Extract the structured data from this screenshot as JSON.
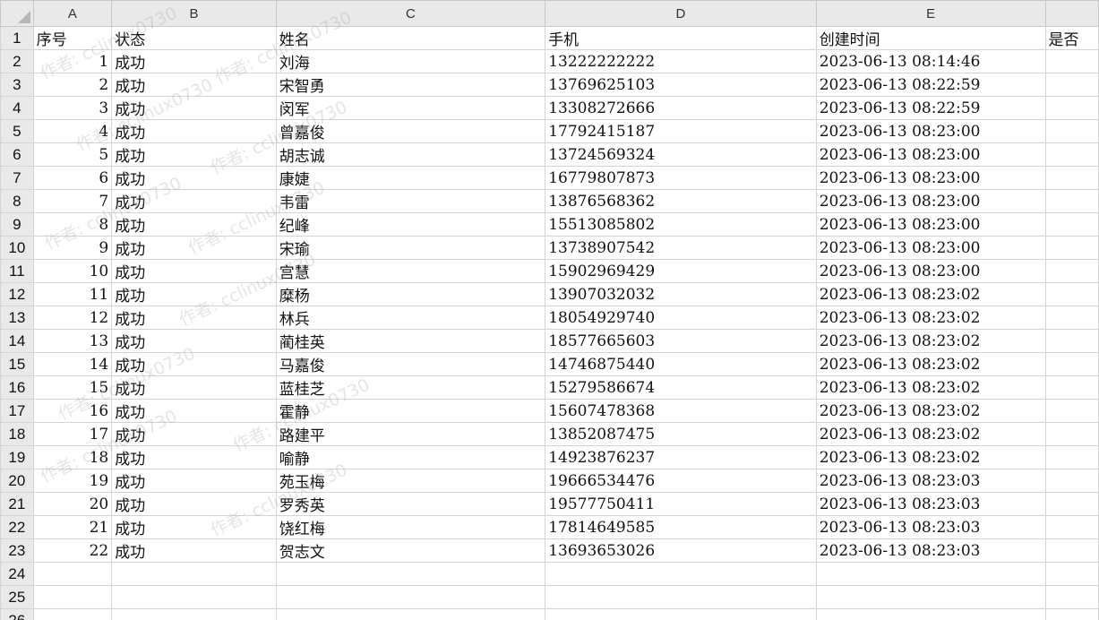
{
  "columns": {
    "A": "A",
    "B": "B",
    "C": "C",
    "D": "D",
    "E": "E"
  },
  "headers": {
    "seq": "序号",
    "status": "状态",
    "name": "姓名",
    "phone": "手机",
    "created": "创建时间",
    "extra": "是否"
  },
  "rows": [
    {
      "seq": "1",
      "status": "成功",
      "name": "刘海",
      "phone": "13222222222",
      "created": "2023-06-13 08:14:46"
    },
    {
      "seq": "2",
      "status": "成功",
      "name": "宋智勇",
      "phone": "13769625103",
      "created": "2023-06-13 08:22:59"
    },
    {
      "seq": "3",
      "status": "成功",
      "name": "闵军",
      "phone": "13308272666",
      "created": "2023-06-13 08:22:59"
    },
    {
      "seq": "4",
      "status": "成功",
      "name": "曾嘉俊",
      "phone": "17792415187",
      "created": "2023-06-13 08:23:00"
    },
    {
      "seq": "5",
      "status": "成功",
      "name": "胡志诚",
      "phone": "13724569324",
      "created": "2023-06-13 08:23:00"
    },
    {
      "seq": "6",
      "status": "成功",
      "name": "康婕",
      "phone": "16779807873",
      "created": "2023-06-13 08:23:00"
    },
    {
      "seq": "7",
      "status": "成功",
      "name": "韦雷",
      "phone": "13876568362",
      "created": "2023-06-13 08:23:00"
    },
    {
      "seq": "8",
      "status": "成功",
      "name": "纪峰",
      "phone": "15513085802",
      "created": "2023-06-13 08:23:00"
    },
    {
      "seq": "9",
      "status": "成功",
      "name": "宋瑜",
      "phone": "13738907542",
      "created": "2023-06-13 08:23:00"
    },
    {
      "seq": "10",
      "status": "成功",
      "name": "宫慧",
      "phone": "15902969429",
      "created": "2023-06-13 08:23:00"
    },
    {
      "seq": "11",
      "status": "成功",
      "name": "糜杨",
      "phone": "13907032032",
      "created": "2023-06-13 08:23:02"
    },
    {
      "seq": "12",
      "status": "成功",
      "name": "林兵",
      "phone": "18054929740",
      "created": "2023-06-13 08:23:02"
    },
    {
      "seq": "13",
      "status": "成功",
      "name": "蔺桂英",
      "phone": "18577665603",
      "created": "2023-06-13 08:23:02"
    },
    {
      "seq": "14",
      "status": "成功",
      "name": "马嘉俊",
      "phone": "14746875440",
      "created": "2023-06-13 08:23:02"
    },
    {
      "seq": "15",
      "status": "成功",
      "name": "蓝桂芝",
      "phone": "15279586674",
      "created": "2023-06-13 08:23:02"
    },
    {
      "seq": "16",
      "status": "成功",
      "name": "霍静",
      "phone": "15607478368",
      "created": "2023-06-13 08:23:02"
    },
    {
      "seq": "17",
      "status": "成功",
      "name": "路建平",
      "phone": "13852087475",
      "created": "2023-06-13 08:23:02"
    },
    {
      "seq": "18",
      "status": "成功",
      "name": "喻静",
      "phone": "14923876237",
      "created": "2023-06-13 08:23:02"
    },
    {
      "seq": "19",
      "status": "成功",
      "name": "苑玉梅",
      "phone": "19666534476",
      "created": "2023-06-13 08:23:03"
    },
    {
      "seq": "20",
      "status": "成功",
      "name": "罗秀英",
      "phone": "19577750411",
      "created": "2023-06-13 08:23:03"
    },
    {
      "seq": "21",
      "status": "成功",
      "name": "饶红梅",
      "phone": "17814649585",
      "created": "2023-06-13 08:23:03"
    },
    {
      "seq": "22",
      "status": "成功",
      "name": "贺志文",
      "phone": "13693653026",
      "created": "2023-06-13 08:23:03"
    }
  ],
  "empty_row_numbers": [
    "24",
    "25",
    "26"
  ],
  "watermark_text": "作者: cclinux0730",
  "colors": {
    "header_bg": "#e9e9e9",
    "grid_line": "#d4d4d4",
    "corner_triangle": "#b7b7b7"
  }
}
